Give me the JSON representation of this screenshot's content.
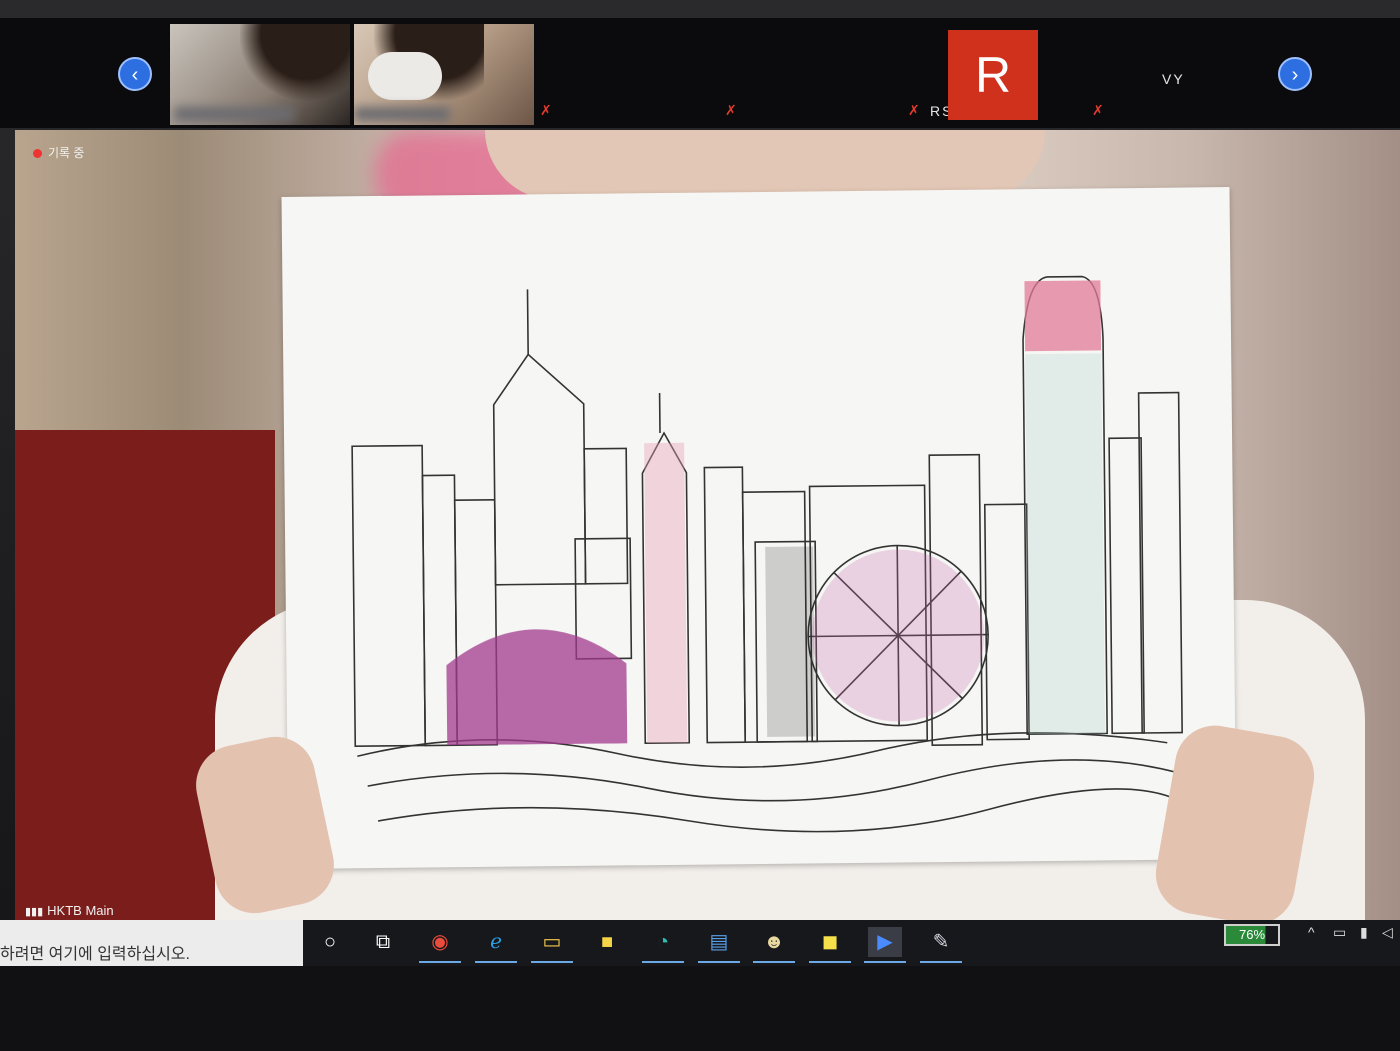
{
  "window": {
    "title": "HKTB Main"
  },
  "participants": {
    "prev_label": "‹",
    "next_label": "›",
    "tiles": [
      {
        "kind": "camera"
      },
      {
        "kind": "camera"
      },
      {
        "kind": "blurred-name"
      },
      {
        "kind": "blurred-name"
      },
      {
        "kind": "avatar",
        "initial": "R",
        "label": "RS",
        "color": "#d0311c"
      },
      {
        "kind": "name",
        "label": "VY"
      }
    ]
  },
  "main_video": {
    "recording_label": "기록 중",
    "meeting_name": "HKTB Main"
  },
  "taskbar": {
    "search_placeholder": "하려면 여기에 입력하십시오.",
    "apps": [
      "cortana",
      "task-view",
      "chrome",
      "internet-explorer",
      "file-explorer",
      "sticky-notes",
      "edge",
      "notepad",
      "game",
      "kakaotalk",
      "zoom",
      "paint"
    ],
    "battery_percent": "76%"
  },
  "colors": {
    "accent": "#2d6fe0",
    "recording": "#e33333",
    "avatar": "#d0311c"
  }
}
